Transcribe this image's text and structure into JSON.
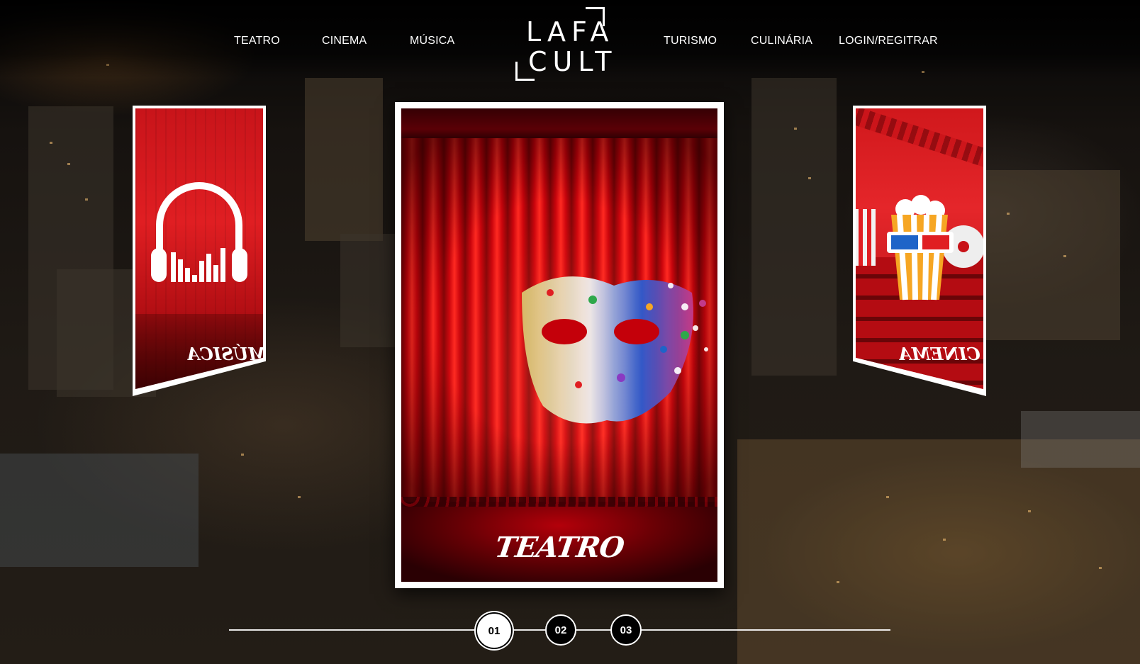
{
  "brand": {
    "logo_line1": "LAFA",
    "logo_line2": "CULT"
  },
  "nav": {
    "left": [
      "TEATRO",
      "CINEMA",
      "MÚSICA"
    ],
    "right": [
      "TURISMO",
      "CULINÁRIA",
      "LOGIN/REGITRAR"
    ]
  },
  "carousel": {
    "active_index": 1,
    "cards": {
      "left": {
        "label": "MÚSICA",
        "icon": "headphones-equalizer-icon"
      },
      "center": {
        "label": "TEATRO",
        "icon": "carnival-mask-icon"
      },
      "right": {
        "label": "CINEMA",
        "icon": "popcorn-3d-glasses-icon"
      }
    },
    "pagination": [
      "01",
      "02",
      "03"
    ]
  },
  "colors": {
    "accent_red": "#e01e22",
    "text": "#ffffff",
    "background": "#0a0706"
  }
}
